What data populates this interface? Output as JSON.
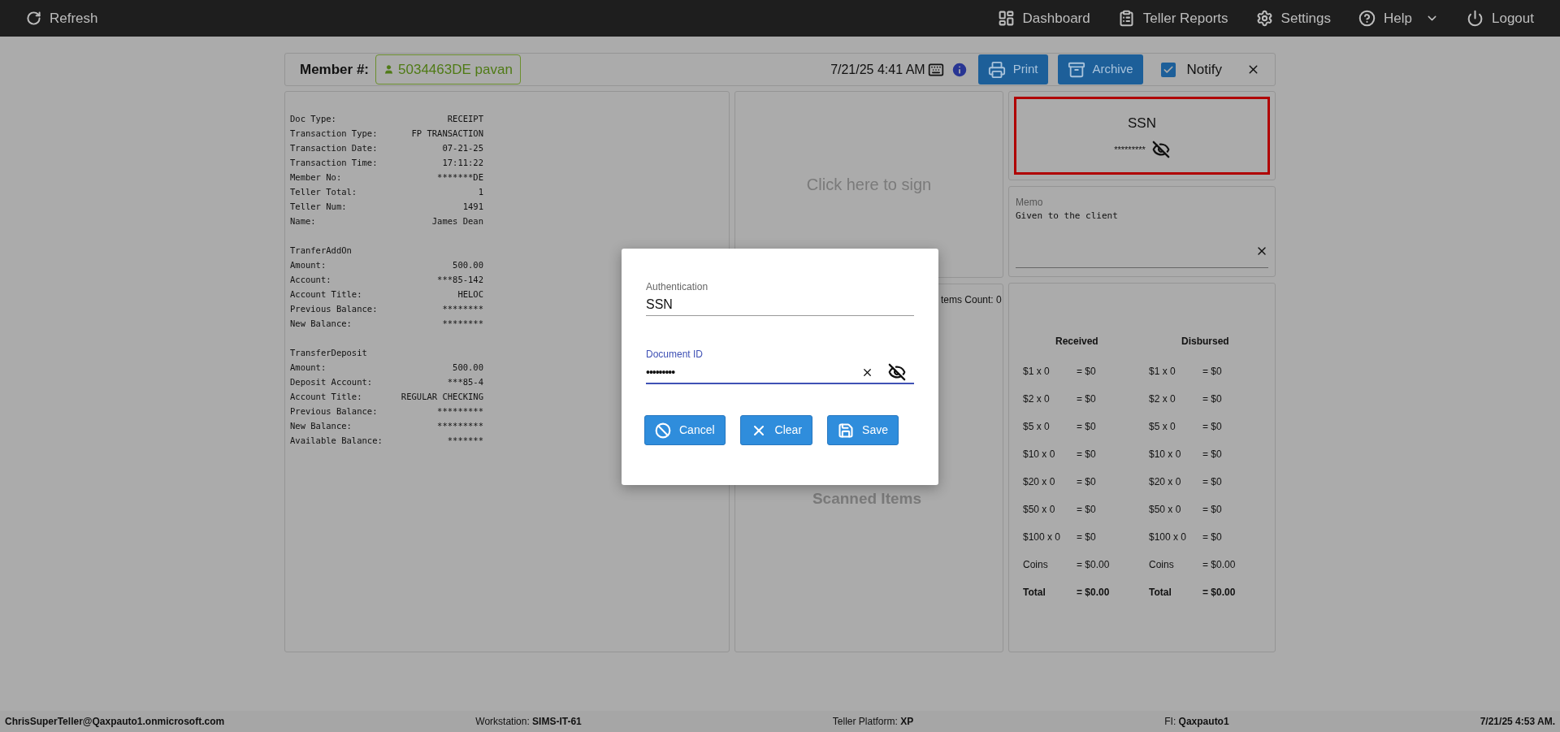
{
  "topbar": {
    "refresh": "Refresh",
    "nav": [
      {
        "label": "Dashboard"
      },
      {
        "label": "Teller Reports"
      },
      {
        "label": "Settings"
      },
      {
        "label": "Help",
        "dropdown": true
      },
      {
        "label": "Logout"
      }
    ]
  },
  "header": {
    "member_label": "Member #:",
    "member_value": "5034463DE pavan",
    "datetime": "7/21/25 4:41 AM",
    "buttons": [
      "Print",
      "Archive"
    ],
    "notify": {
      "label": "Notify",
      "checked": true
    }
  },
  "receipt": [
    {
      "lines": [
        {
          "label": "Doc Type:",
          "value": "RECEIPT"
        },
        {
          "label": "Transaction Type:",
          "value": "FP TRANSACTION"
        },
        {
          "label": "Transaction Date:",
          "value": "07-21-25"
        },
        {
          "label": "Transaction Time:",
          "value": "17:11:22"
        },
        {
          "label": "Member No:",
          "value": "*******DE"
        },
        {
          "label": "Teller Total:",
          "value": "1"
        },
        {
          "label": "Teller Num:",
          "value": "1491"
        },
        {
          "label": "Name:",
          "value": "James Dean"
        }
      ]
    },
    {
      "title": "TranferAddOn",
      "lines": [
        {
          "label": "Amount:",
          "value": "500.00"
        },
        {
          "label": "Account:",
          "value": "***85-142"
        },
        {
          "label": "Account Title:",
          "value": "HELOC"
        },
        {
          "label": "Previous Balance:",
          "value": "********"
        },
        {
          "label": "New Balance:",
          "value": "********"
        }
      ]
    },
    {
      "title": "TransferDeposit",
      "lines": [
        {
          "label": "Amount:",
          "value": "500.00"
        },
        {
          "label": "Deposit Account:",
          "value": "***85-4"
        },
        {
          "label": "Account Title:",
          "value": "REGULAR CHECKING"
        },
        {
          "label": "Previous Balance:",
          "value": "*********"
        },
        {
          "label": "New Balance:",
          "value": "*********"
        },
        {
          "label": "Available Balance:",
          "value": "*******"
        }
      ]
    }
  ],
  "signature": {
    "prompt": "Click here to sign"
  },
  "items": {
    "count": "tems Count: 0",
    "title": "Scanned Items"
  },
  "auth_card": {
    "title": "SSN",
    "masked": "*********"
  },
  "memo": {
    "label": "Memo",
    "value": "Given to the client"
  },
  "cash": [
    {
      "heading": "Received",
      "rows": [
        {
          "denom": "$1 x 0",
          "amount": "= $0"
        },
        {
          "denom": "$2 x 0",
          "amount": "= $0"
        },
        {
          "denom": "$5 x 0",
          "amount": "= $0"
        },
        {
          "denom": "$10 x 0",
          "amount": "= $0"
        },
        {
          "denom": "$20 x 0",
          "amount": "= $0"
        },
        {
          "denom": "$50 x 0",
          "amount": "= $0"
        },
        {
          "denom": "$100 x 0",
          "amount": "= $0"
        },
        {
          "denom": "Coins",
          "amount": "= $0.00"
        },
        {
          "denom": "Total",
          "amount": "= $0.00",
          "kind": "total"
        }
      ]
    },
    {
      "heading": "Disbursed",
      "rows": [
        {
          "denom": "$1 x 0",
          "amount": "= $0"
        },
        {
          "denom": "$2 x 0",
          "amount": "= $0"
        },
        {
          "denom": "$5 x 0",
          "amount": "= $0"
        },
        {
          "denom": "$10 x 0",
          "amount": "= $0"
        },
        {
          "denom": "$20 x 0",
          "amount": "= $0"
        },
        {
          "denom": "$50 x 0",
          "amount": "= $0"
        },
        {
          "denom": "$100 x 0",
          "amount": "= $0"
        },
        {
          "denom": "Coins",
          "amount": "= $0.00"
        },
        {
          "denom": "Total",
          "amount": "= $0.00",
          "kind": "total"
        }
      ]
    }
  ],
  "modal": {
    "fields": [
      {
        "label": "Authentication",
        "value": "SSN",
        "focused": false
      },
      {
        "label": "Document ID",
        "value": "•••••••••",
        "focused": true,
        "masked": true
      }
    ],
    "buttons": [
      "Cancel",
      "Clear",
      "Save"
    ]
  },
  "status_bar": [
    {
      "value": "ChrisSuperTeller@Qaxpauto1.onmicrosoft.com"
    },
    {
      "label": "Workstation:",
      "value": "SIMS-IT-61"
    },
    {
      "label": "Teller Platform:",
      "value": "XP"
    },
    {
      "label": "FI:",
      "value": "Qaxpauto1"
    },
    {
      "value": "7/21/25 4:53 AM."
    }
  ]
}
